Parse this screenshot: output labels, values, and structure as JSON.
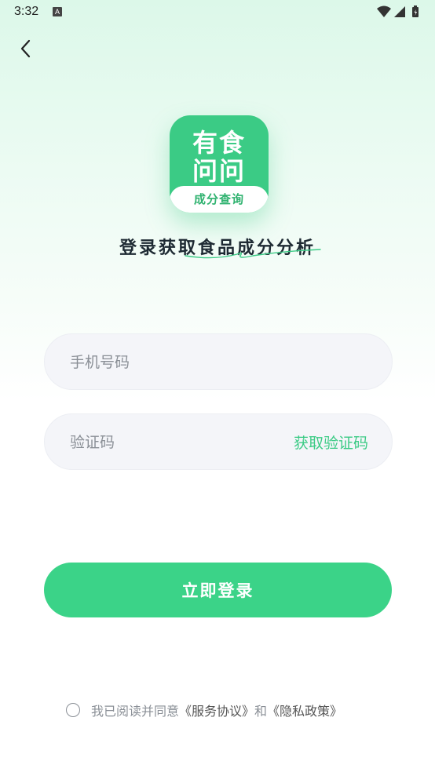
{
  "status_bar": {
    "time": "3:32",
    "notification_icon": "A"
  },
  "icons": {
    "back": "chevron-left-icon",
    "wifi": "wifi-icon",
    "signal": "signal-icon",
    "battery": "battery-icon"
  },
  "logo": {
    "line1": "有食",
    "line2": "问问",
    "subtitle": "成分查询"
  },
  "headline": "登录获取食品成分分析",
  "form": {
    "phone_placeholder": "手机号码",
    "code_placeholder": "验证码",
    "get_code_label": "获取验证码"
  },
  "login_button_label": "立即登录",
  "agreement": {
    "prefix": "我已阅读并同意",
    "service_link": "《服务协议》",
    "and": "和",
    "privacy_link": "《隐私政策》"
  },
  "colors": {
    "accent": "#3bd388",
    "logo_green": "#3bcb85"
  }
}
